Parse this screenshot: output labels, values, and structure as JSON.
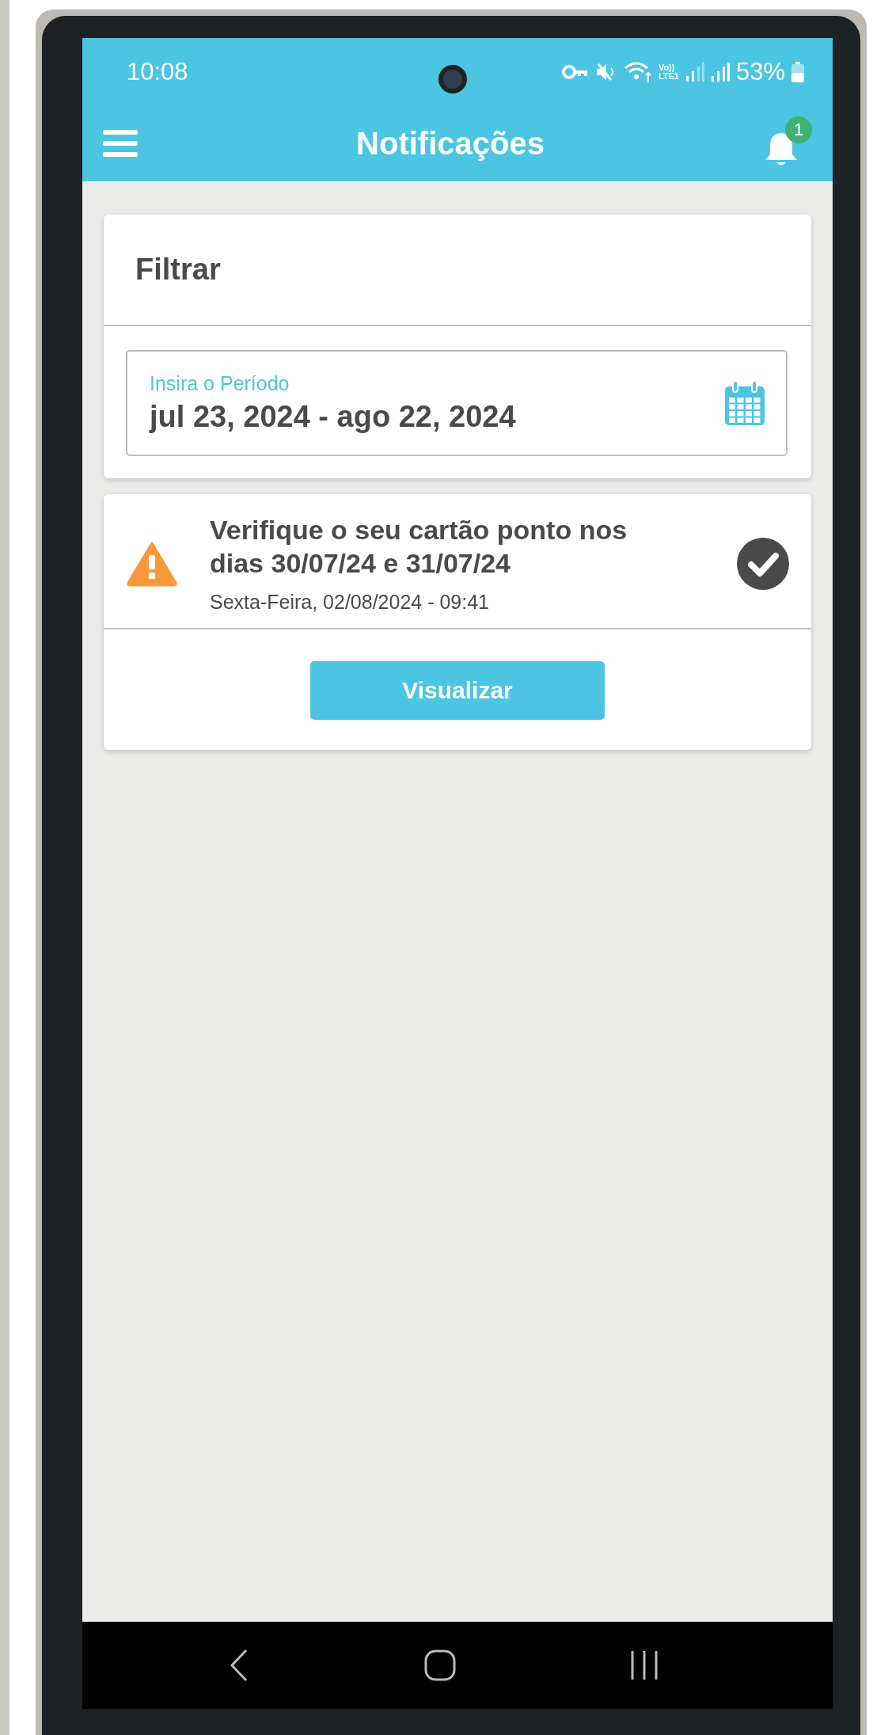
{
  "status_bar": {
    "time": "10:08",
    "network_top": "Vo))",
    "network_bottom": "LTE1",
    "battery": "53%"
  },
  "app_bar": {
    "title": "Notificações",
    "notification_count": "1"
  },
  "filter": {
    "title": "Filtrar",
    "period_field": {
      "label": "Insira o Período",
      "value": "jul 23, 2024 - ago 22, 2024"
    }
  },
  "notifications": [
    {
      "kind": "warning",
      "title": "Verifique o seu cartão ponto nos dias 30/07/24 e 31/07/24",
      "date": "Sexta-Feira, 02/08/2024 - 09:41",
      "read": true,
      "button": "Visualizar"
    }
  ]
}
